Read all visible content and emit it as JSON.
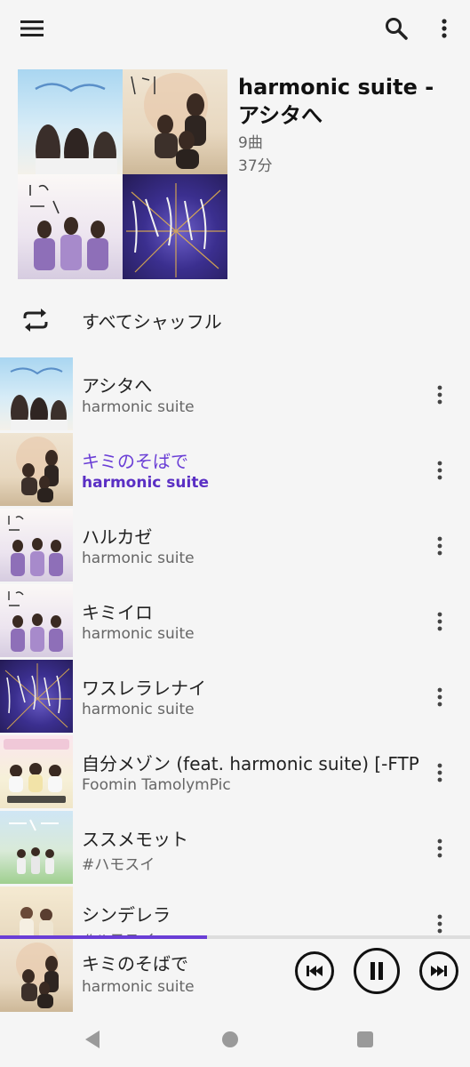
{
  "album": {
    "title": "harmonic suite - アシタへ",
    "track_count": "9曲",
    "duration": "37分"
  },
  "shuffle": {
    "label": "すべてシャッフル"
  },
  "tracks": [
    {
      "title": "アシタへ",
      "artist": "harmonic suite",
      "active": false
    },
    {
      "title": "キミのそばで",
      "artist": "harmonic suite",
      "active": true
    },
    {
      "title": "ハルカゼ",
      "artist": "harmonic suite",
      "active": false
    },
    {
      "title": "キミイロ",
      "artist": "harmonic suite",
      "active": false
    },
    {
      "title": "ワスレラレナイ",
      "artist": "harmonic suite",
      "active": false
    },
    {
      "title": "自分メゾン (feat. harmonic suite) [-FTP ve",
      "artist": "Foomin TamolymPic",
      "active": false
    },
    {
      "title": "ススメモット",
      "artist": "#ハモスイ",
      "active": false
    },
    {
      "title": "シンデレラ",
      "artist": "#ハモスイ",
      "active": false
    }
  ],
  "now_playing": {
    "title": "キミのそばで",
    "artist": "harmonic suite",
    "progress": 0.44
  },
  "colors": {
    "accent": "#6a3ed6",
    "background": "#f5f5f5",
    "secondary_text": "#666666"
  },
  "icons": [
    "menu-icon",
    "search-icon",
    "more-vert-icon",
    "repeat-icon",
    "skip-previous-icon",
    "pause-icon",
    "skip-next-icon",
    "nav-back-icon",
    "nav-home-icon",
    "nav-recents-icon"
  ]
}
